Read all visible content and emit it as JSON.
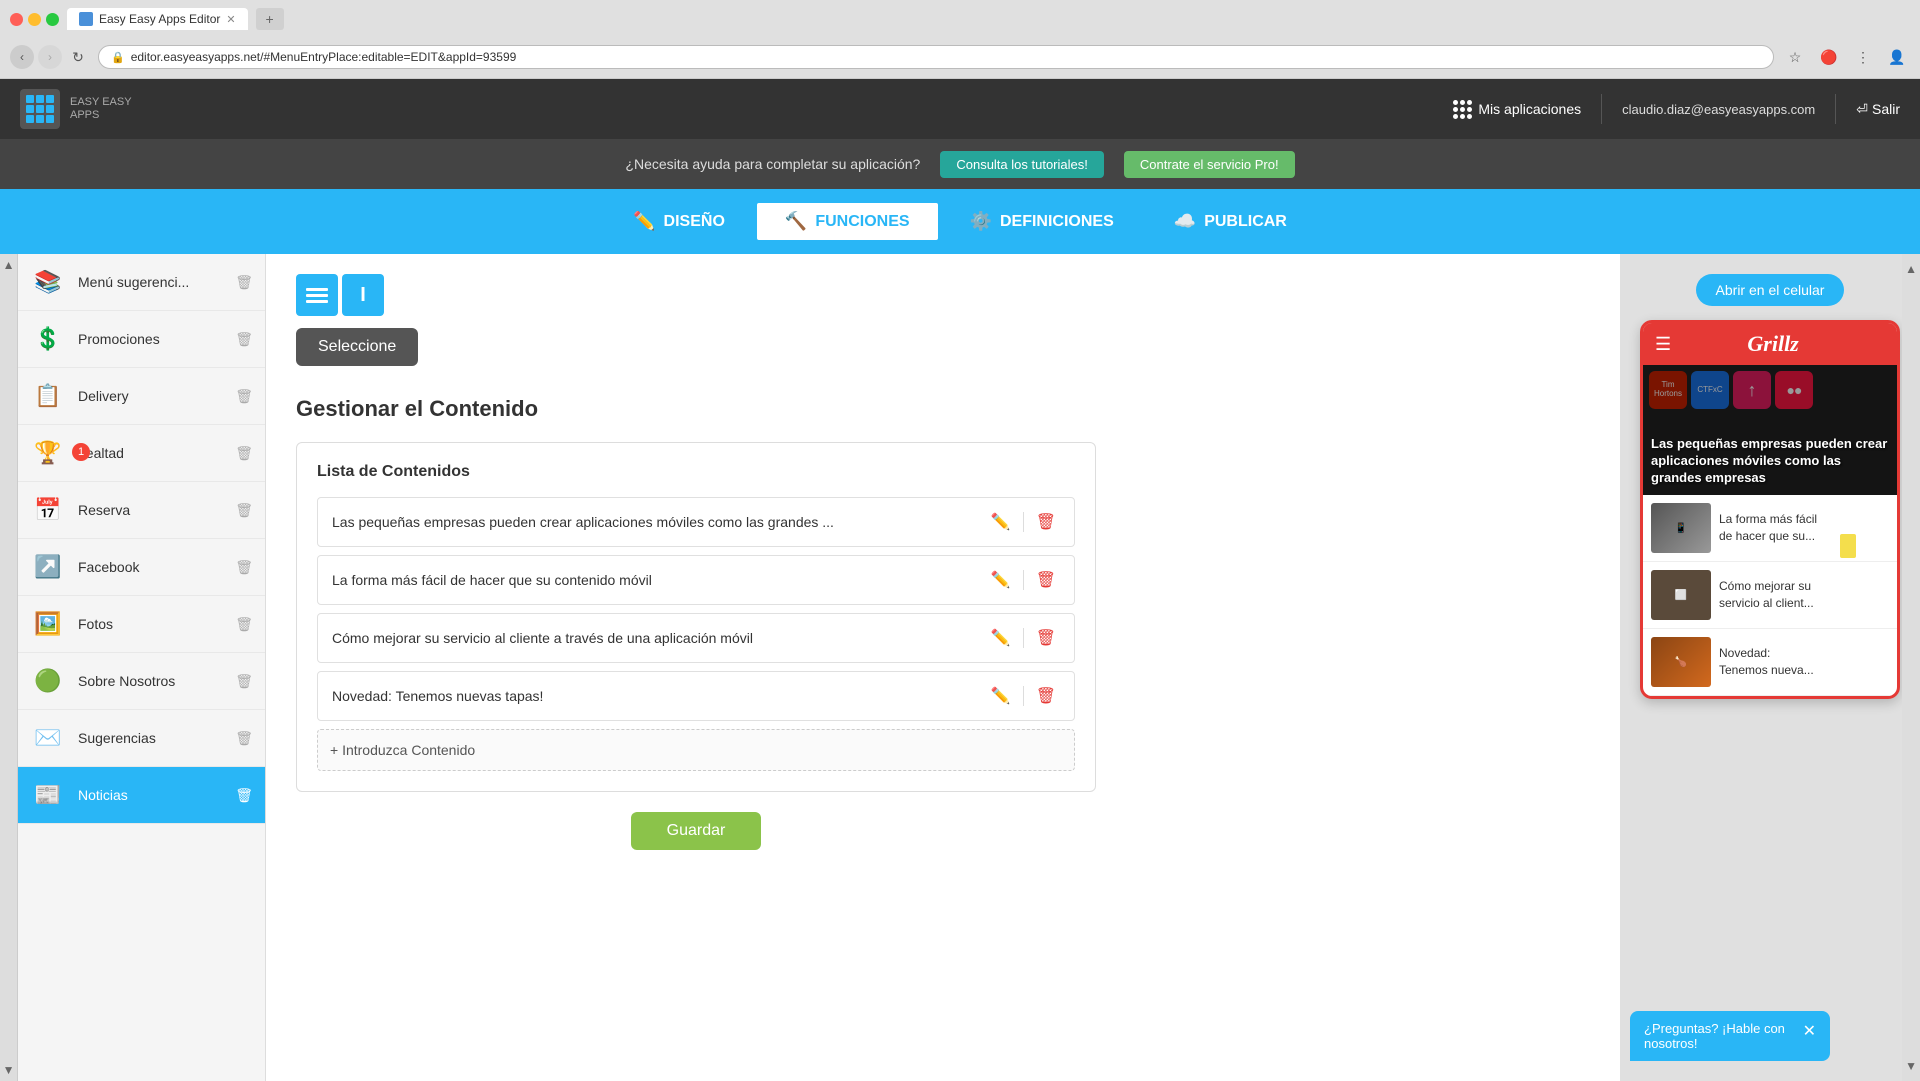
{
  "browser": {
    "tab_title": "Easy Easy Apps Editor",
    "url": "editor.easyeasyapps.net/#MenuEntryPlace:editable=EDIT&appId=93599",
    "new_tab_label": "+"
  },
  "header": {
    "logo_text": "EASY EASY",
    "logo_subtext": "APPS",
    "apps_label": "Mis aplicaciones",
    "email": "claudio.diaz@easyeasyapps.com",
    "logout_label": "Salir"
  },
  "helpbar": {
    "text": "¿Necesita ayuda para completar su aplicación?",
    "tutorials_btn": "Consulta los tutoriales!",
    "pro_btn": "Contrate el servicio Pro!"
  },
  "nav": {
    "tabs": [
      {
        "id": "diseno",
        "label": "DISEÑO",
        "icon": "✏️"
      },
      {
        "id": "funciones",
        "label": "FUNCIONES",
        "icon": "🔨",
        "active": true
      },
      {
        "id": "definiciones",
        "label": "DEFINICIONES",
        "icon": "⚙️"
      },
      {
        "id": "publicar",
        "label": "PUBLICAR",
        "icon": "☁️"
      }
    ]
  },
  "sidebar": {
    "items": [
      {
        "id": "menu-sugerencias",
        "label": "Menú sugerenci...",
        "icon": "📚"
      },
      {
        "id": "promociones",
        "label": "Promociones",
        "icon": "💲"
      },
      {
        "id": "delivery",
        "label": "Delivery",
        "icon": "📋"
      },
      {
        "id": "lealtad",
        "label": "Lealtad",
        "icon": "🏆",
        "badge": "1"
      },
      {
        "id": "reserva",
        "label": "Reserva",
        "icon": "📅"
      },
      {
        "id": "facebook",
        "label": "Facebook",
        "icon": "↗️"
      },
      {
        "id": "fotos",
        "label": "Fotos",
        "icon": "🖼️"
      },
      {
        "id": "sobre-nosotros",
        "label": "Sobre Nosotros",
        "icon": "🟢"
      },
      {
        "id": "sugerencias",
        "label": "Sugerencias",
        "icon": "✉️"
      },
      {
        "id": "noticias",
        "label": "Noticias",
        "icon": "📰",
        "active": true
      }
    ]
  },
  "content": {
    "select_btn_label": "Seleccione",
    "section_title": "Gestionar el Contenido",
    "list_title": "Lista de Contenidos",
    "items": [
      {
        "text": "Las pequeñas empresas pueden crear aplicaciones móviles como las grandes ..."
      },
      {
        "text": "La forma más fácil de hacer que su contenido móvil"
      },
      {
        "text": "Cómo mejorar su servicio al cliente a través de una aplicación móvil"
      },
      {
        "text": "Novedad: Tenemos nuevas tapas!"
      }
    ],
    "add_btn_label": "+ Introduzca Contenido",
    "save_btn_label": "Guardar"
  },
  "preview": {
    "open_btn_label": "Abrir en el celular",
    "logo_text": "Grillz",
    "hero_text": "Las pequeñas empresas pueden crear aplicaciones móviles como las grandes empresas",
    "news_items": [
      {
        "title": "La forma más fácil de hacer que su..."
      },
      {
        "title": "Cómo mejorar su servicio al client..."
      },
      {
        "title": "Novedad: Tenemos nueva..."
      }
    ],
    "hero_icons": [
      {
        "label": "Tim Hortons",
        "id": "tb"
      },
      {
        "label": "CTFxC",
        "id": "ctfc"
      },
      {
        "label": "",
        "id": "up"
      },
      {
        "label": "Flickr",
        "id": "fl"
      }
    ]
  },
  "chat": {
    "text": "¿Preguntas? ¡Hable con nosotros!"
  }
}
